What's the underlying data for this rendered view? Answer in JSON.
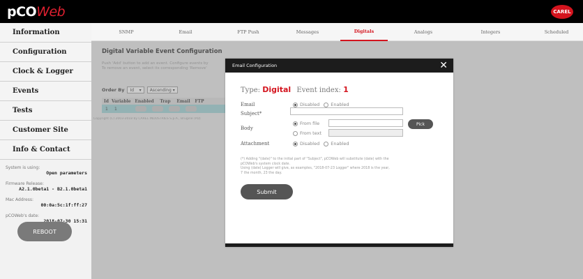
{
  "header": {
    "logo_main": "pCO",
    "logo_accent": "Web",
    "brand": "CAREL"
  },
  "sidebar": {
    "items": [
      {
        "label": "Information"
      },
      {
        "label": "Configuration"
      },
      {
        "label": "Clock & Logger"
      },
      {
        "label": "Events"
      },
      {
        "label": "Tests"
      },
      {
        "label": "Customer Site"
      },
      {
        "label": "Info & Contact"
      }
    ],
    "system_label": "System is using:",
    "system_value": "Open parameters",
    "firmware_label": "Firmware Release:",
    "firmware_value": "A2.1.0beta1 - B2.1.0beta1",
    "mac_label": "Mac Address:",
    "mac_value": "00:0a:5c:1f:ff:27",
    "date_label": "pCOWeb's date:",
    "date_value": "2018-07-30 15:31",
    "reboot_label": "REBOOT"
  },
  "tabs": [
    {
      "label": "SNMP"
    },
    {
      "label": "Email"
    },
    {
      "label": "FTP Push"
    },
    {
      "label": "Messages"
    },
    {
      "label": "Digitals",
      "active": true
    },
    {
      "label": "Analogs"
    },
    {
      "label": "Integers"
    },
    {
      "label": "Scheduled"
    }
  ],
  "main": {
    "title": "Digital Variable Event Configuration",
    "desc_line1": "Push 'Add' button to add an event. Configure events by",
    "desc_line2": "To remove an event, select its corresponding 'Remove'",
    "order_by_label": "Order By",
    "order_by_value": "Id",
    "order_dir_value": "Ascending",
    "table_headers": [
      "Id",
      "Variable",
      "Enabled",
      "Trap",
      "Email",
      "FTP"
    ],
    "table_row": {
      "id": "1",
      "variable": "1"
    },
    "copyright": "Copyright (C) 2003-2018 by CAREL INDUSTRIES S.p.A., Brugine (PD)"
  },
  "modal": {
    "title": "Email Configuration",
    "close_glyph": "✕",
    "type_label": "Type:",
    "type_value": "Digital",
    "event_label": "Event index:",
    "event_value": "1",
    "email_label": "Email",
    "opt_disabled": "Disabled",
    "opt_enabled": "Enabled",
    "subject_label": "Subject*",
    "body_label": "Body",
    "from_file": "From file",
    "from_text": "From text",
    "pick_label": "Pick",
    "attachment_label": "Attachment",
    "note_line1": "(*) Adding \"(date)\" to the initial part of \"Subject\", pCOWeb will substitute (date) with the",
    "note_line2": "pCOWeb's system clock date.",
    "note_line3": "Using (date) Logger will give, as examples, \"2018-07-23 Logger\" where 2018 is the year,",
    "note_line4": "7 the month, 23 the day.",
    "submit_label": "Submit"
  }
}
